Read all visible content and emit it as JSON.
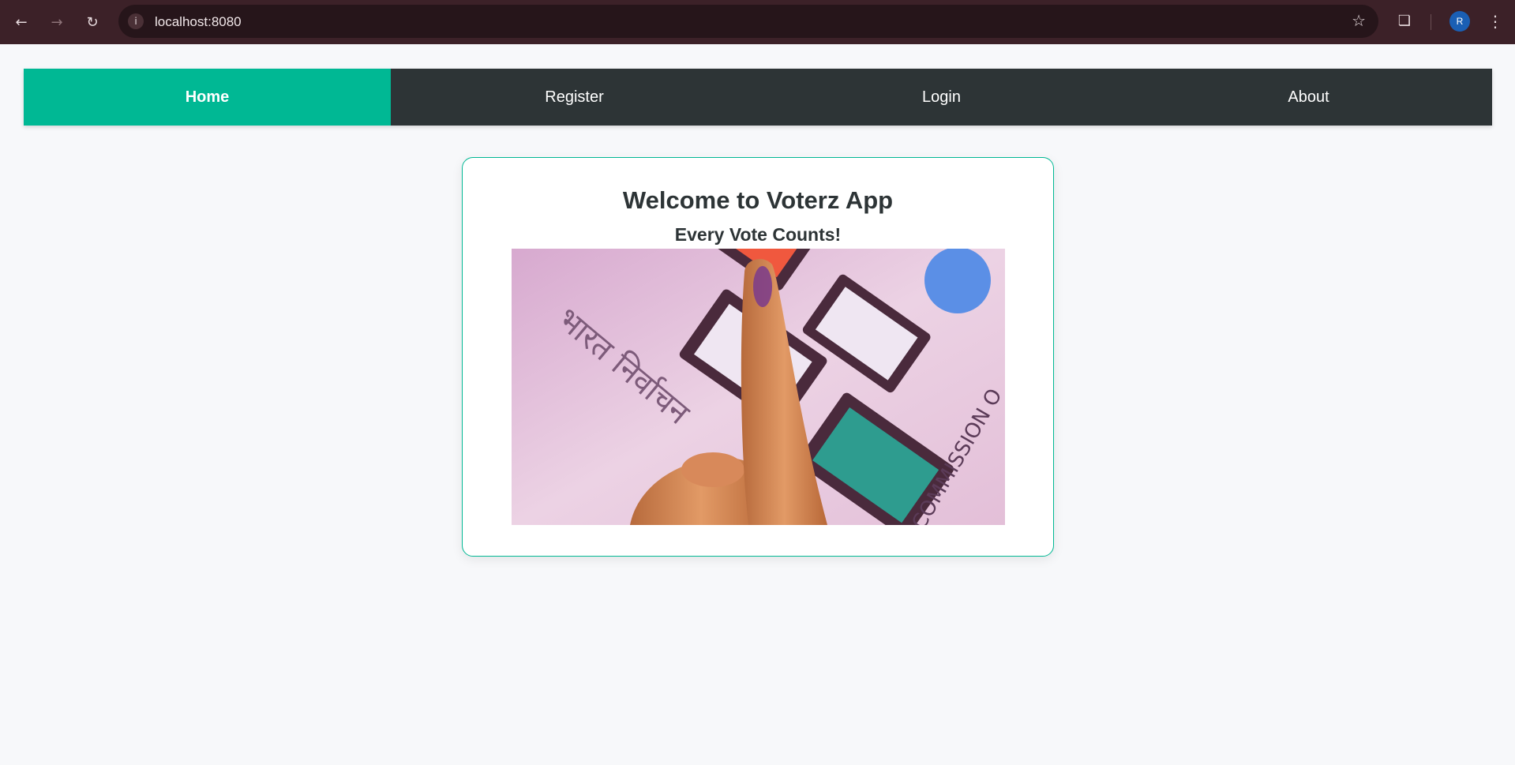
{
  "browser": {
    "url": "localhost:8080",
    "profile_initial": "R",
    "icons": {
      "back": "arrow-left-icon",
      "forward": "arrow-right-icon",
      "reload": "reload-icon",
      "site_info": "info-icon",
      "bookmark": "star-icon",
      "extensions": "puzzle-icon",
      "menu": "kebab-menu-icon"
    }
  },
  "nav": {
    "items": [
      {
        "label": "Home",
        "active": true
      },
      {
        "label": "Register",
        "active": false
      },
      {
        "label": "Login",
        "active": false
      },
      {
        "label": "About",
        "active": false
      }
    ]
  },
  "card": {
    "title": "Welcome to Voterz App",
    "subtitle": "Every Vote Counts!",
    "image": {
      "description": "hero-voting-finger-image",
      "watermark_text_left": "भारत निर्वाचन",
      "watermark_text_right": "ON COMMISSION O"
    }
  },
  "colors": {
    "accent": "#00b894",
    "navbar_bg": "#2d3436",
    "text_dark": "#2d3436",
    "page_bg": "#f7f8fa",
    "chrome_bg": "#3c2128"
  }
}
